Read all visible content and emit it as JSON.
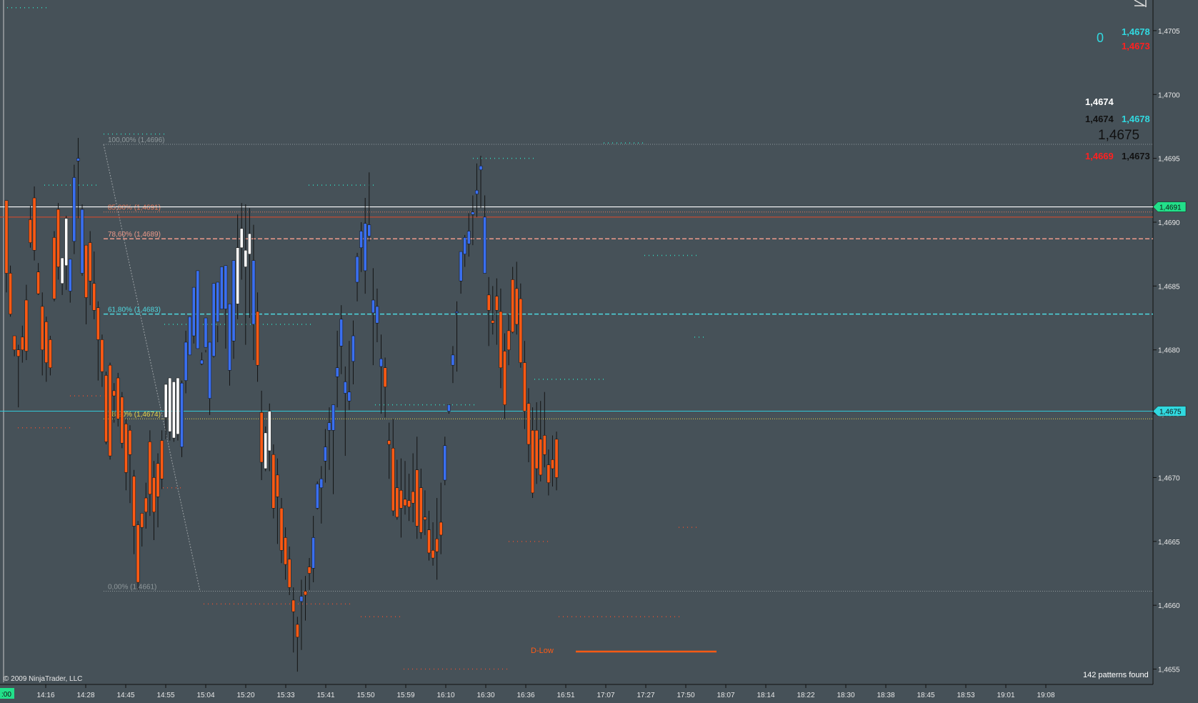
{
  "chart_data": {
    "type": "candlestick",
    "ylim": [
      1.46538,
      1.47074
    ],
    "grid": false,
    "y_tick_labels": [
      "1,4705",
      "1,4700",
      "1,4695",
      "1,4690",
      "1,4685",
      "1,4680",
      "1,4675",
      "1,4670",
      "1,4665",
      "1,4660",
      "1,4655"
    ],
    "y_tick_values": [
      1.4705,
      1.47,
      1.4695,
      1.469,
      1.4685,
      1.468,
      1.4675,
      1.467,
      1.4665,
      1.466,
      1.4655
    ],
    "x_tick_labels": [
      "14:16",
      "14:28",
      "14:45",
      "14:55",
      "15:04",
      "15:20",
      "15:33",
      "15:41",
      "15:50",
      "15:59",
      "16:10",
      "16:30",
      "16:36",
      "16:51",
      "17:07",
      "17:27",
      "17:50",
      "18:07",
      "18:14",
      "18:22",
      "18:30",
      "18:38",
      "18:45",
      "18:53",
      "19:01",
      "19:08"
    ],
    "first_axis_label": ":00",
    "price_tags": [
      {
        "label": "1,4691",
        "value": 1.46912
      },
      {
        "label": "1,4675",
        "value": 1.46752
      }
    ],
    "fib_levels": [
      {
        "label": "100,00% (1,4696)",
        "value": 1.46961,
        "color": "#8f989b"
      },
      {
        "label": "85,00% (1,4691)",
        "value": 1.46908,
        "color": "#e87a5a"
      },
      {
        "label": "78,60% (1,4689)",
        "value": 1.46887,
        "color": "#ee9a8a"
      },
      {
        "label": "61,80% (1,4683)",
        "value": 1.46828,
        "color": "#4fd8e0"
      },
      {
        "label": "38,20% (1,4674)",
        "value": 1.46746,
        "color": "#e8d44a"
      },
      {
        "label": "0,00% (1,4661)",
        "value": 1.46611,
        "color": "#8f989b"
      }
    ],
    "dlow_label": "D-Low",
    "watermark": "© 2009 NinjaTrader, LLC",
    "patterns_text": "142 patterns found",
    "candles": [
      [
        1.46917,
        1.46917,
        1.46845,
        1.4686,
        "o"
      ],
      [
        1.4686,
        1.46866,
        1.46826,
        1.46828,
        "o"
      ],
      [
        1.46811,
        1.46811,
        1.46795,
        1.468,
        "o"
      ],
      [
        1.468,
        1.46804,
        1.46755,
        1.46795,
        "o"
      ],
      [
        1.468,
        1.46819,
        1.4679,
        1.4681,
        "o"
      ],
      [
        1.46839,
        1.46851,
        1.46792,
        1.46799,
        "o"
      ],
      [
        1.46902,
        1.46913,
        1.4688,
        1.46884,
        "o"
      ],
      [
        1.46919,
        1.46928,
        1.4687,
        1.46878,
        "o"
      ],
      [
        1.46861,
        1.46868,
        1.46843,
        1.46844,
        "o"
      ],
      [
        1.46834,
        1.46845,
        1.4678,
        1.468,
        "o"
      ],
      [
        1.46822,
        1.46826,
        1.46775,
        1.4679,
        "o"
      ],
      [
        1.46808,
        1.46811,
        1.4678,
        1.46786,
        "o"
      ],
      [
        1.46888,
        1.46893,
        1.46838,
        1.4684,
        "o"
      ],
      [
        1.4691,
        1.46915,
        1.46855,
        1.46865,
        "o"
      ],
      [
        1.46852,
        1.46871,
        1.46843,
        1.46872,
        "w"
      ],
      [
        1.46866,
        1.46905,
        1.46847,
        1.46903,
        "w"
      ],
      [
        1.46846,
        1.4687,
        1.46837,
        1.46871,
        "b"
      ],
      [
        1.46885,
        1.46945,
        1.46875,
        1.46935,
        "b"
      ],
      [
        1.46948,
        1.46966,
        1.46903,
        1.4695,
        "b"
      ],
      [
        1.4691,
        1.46914,
        1.46858,
        1.4686,
        "b"
      ],
      [
        1.46841,
        1.46875,
        1.4682,
        1.46882,
        "o"
      ],
      [
        1.46884,
        1.46893,
        1.46835,
        1.46854,
        "o"
      ],
      [
        1.46852,
        1.46877,
        1.46824,
        1.46831,
        "o"
      ],
      [
        1.46833,
        1.46838,
        1.46776,
        1.46808,
        "o"
      ],
      [
        1.46808,
        1.46812,
        1.46771,
        1.46783,
        "o"
      ],
      [
        1.4678,
        1.46783,
        1.46726,
        1.46728,
        "o"
      ],
      [
        1.46788,
        1.4679,
        1.46714,
        1.46717,
        "o"
      ],
      [
        1.46768,
        1.46774,
        1.46743,
        1.46764,
        "o"
      ],
      [
        1.46778,
        1.46782,
        1.4674,
        1.46746,
        "o"
      ],
      [
        1.46763,
        1.46767,
        1.46723,
        1.46727,
        "o"
      ],
      [
        1.46742,
        1.46746,
        1.4669,
        1.46704,
        "o"
      ],
      [
        1.46737,
        1.46741,
        1.4668,
        1.46718,
        "o"
      ],
      [
        1.46701,
        1.46706,
        1.4664,
        1.46662,
        "o"
      ],
      [
        1.46663,
        1.46666,
        1.46612,
        1.46618,
        "o"
      ],
      [
        1.46661,
        1.46672,
        1.46646,
        1.46672,
        "o"
      ],
      [
        1.46684,
        1.46696,
        1.4666,
        1.46673,
        "o"
      ],
      [
        1.46728,
        1.46737,
        1.4667,
        1.46687,
        "o"
      ],
      [
        1.467,
        1.46713,
        1.46651,
        1.46673,
        "o"
      ],
      [
        1.46711,
        1.46719,
        1.46661,
        1.46685,
        "o"
      ],
      [
        1.46729,
        1.46737,
        1.46691,
        1.46699,
        "o"
      ],
      [
        1.46747,
        1.46767,
        1.4673,
        1.46773,
        "w"
      ],
      [
        1.46736,
        1.46776,
        1.46729,
        1.46778,
        "w"
      ],
      [
        1.46731,
        1.46769,
        1.46728,
        1.46775,
        "w"
      ],
      [
        1.46734,
        1.46768,
        1.46729,
        1.46778,
        "w"
      ],
      [
        1.46724,
        1.46776,
        1.46716,
        1.46774,
        "b"
      ],
      [
        1.46776,
        1.46815,
        1.46766,
        1.46806,
        "b"
      ],
      [
        1.46796,
        1.46824,
        1.46796,
        1.46826,
        "b"
      ],
      [
        1.46811,
        1.46831,
        1.46805,
        1.46849,
        "b"
      ],
      [
        1.46801,
        1.46812,
        1.46801,
        1.46862,
        "b"
      ],
      [
        1.46789,
        1.46798,
        1.46788,
        1.46792,
        "b"
      ],
      [
        1.46802,
        1.468,
        1.46798,
        1.46825,
        "b"
      ],
      [
        1.46762,
        1.46778,
        1.46749,
        1.46806,
        "b"
      ],
      [
        1.46795,
        1.46803,
        1.46794,
        1.46852,
        "b"
      ],
      [
        1.46822,
        1.46819,
        1.46806,
        1.46853,
        "b"
      ],
      [
        1.46832,
        1.46841,
        1.46836,
        1.46865,
        "b"
      ],
      [
        1.46832,
        1.46864,
        1.46801,
        1.46866,
        "b"
      ],
      [
        1.46784,
        1.46833,
        1.46772,
        1.46836,
        "b"
      ],
      [
        1.46807,
        1.46868,
        1.46793,
        1.4687,
        "b"
      ],
      [
        1.46836,
        1.46906,
        1.46824,
        1.4688,
        "w"
      ],
      [
        1.4688,
        1.46915,
        1.46855,
        1.46895,
        "w"
      ],
      [
        1.46865,
        1.46914,
        1.46804,
        1.46878,
        "w"
      ],
      [
        1.46875,
        1.46911,
        1.46825,
        1.46891,
        "w"
      ],
      [
        1.4682,
        1.46898,
        1.46792,
        1.4687,
        "b"
      ],
      [
        1.4683,
        1.46845,
        1.46775,
        1.46788,
        "o"
      ],
      [
        1.46751,
        1.46768,
        1.46698,
        1.46712,
        "o"
      ],
      [
        1.46735,
        1.4674,
        1.46705,
        1.46707,
        "w"
      ],
      [
        1.46721,
        1.46758,
        1.46705,
        1.46752,
        "w"
      ],
      [
        1.46718,
        1.46726,
        1.46668,
        1.46676,
        "o"
      ],
      [
        1.46702,
        1.46715,
        1.46648,
        1.46685,
        "o"
      ],
      [
        1.46676,
        1.46684,
        1.46633,
        1.46643,
        "o"
      ],
      [
        1.46653,
        1.46661,
        1.4662,
        1.46632,
        "o"
      ],
      [
        1.46636,
        1.46646,
        1.46608,
        1.46614,
        "o"
      ],
      [
        1.46604,
        1.46614,
        1.46563,
        1.46595,
        "o"
      ],
      [
        1.46575,
        1.46591,
        1.46548,
        1.46585,
        "o"
      ],
      [
        1.46607,
        1.4662,
        1.46565,
        1.46603,
        "b"
      ],
      [
        1.46608,
        1.46623,
        1.46588,
        1.46611,
        "o"
      ],
      [
        1.4663,
        1.46637,
        1.46612,
        1.46625,
        "o"
      ],
      [
        1.46653,
        1.4667,
        1.46618,
        1.46629,
        "b"
      ],
      [
        1.46676,
        1.46697,
        1.46675,
        1.46695,
        "b"
      ],
      [
        1.46692,
        1.46709,
        1.46664,
        1.46699,
        "b"
      ],
      [
        1.46713,
        1.46738,
        1.46696,
        1.46724,
        "b"
      ],
      [
        1.46737,
        1.46755,
        1.46706,
        1.46743,
        "b"
      ],
      [
        1.46737,
        1.46755,
        1.46687,
        1.46757,
        "b"
      ],
      [
        1.46786,
        1.46815,
        1.46755,
        1.46779,
        "b"
      ],
      [
        1.46824,
        1.46835,
        1.46781,
        1.46803,
        "b"
      ],
      [
        1.46775,
        1.46787,
        1.46717,
        1.46766,
        "b"
      ],
      [
        1.46767,
        1.46807,
        1.46753,
        1.4676,
        "b"
      ],
      [
        1.46791,
        1.46823,
        1.46773,
        1.46811,
        "b"
      ],
      [
        1.46853,
        1.46876,
        1.46838,
        1.46873,
        "b"
      ],
      [
        1.4688,
        1.469,
        1.46861,
        1.46893,
        "b"
      ],
      [
        1.46862,
        1.46919,
        1.46844,
        1.46899,
        "b"
      ],
      [
        1.46889,
        1.46939,
        1.46885,
        1.46898,
        "b"
      ],
      [
        1.46839,
        1.46864,
        1.46788,
        1.46829,
        "b"
      ],
      [
        1.46834,
        1.46848,
        1.46806,
        1.46821,
        "b"
      ],
      [
        1.46793,
        1.46812,
        1.4675,
        1.46787,
        "b"
      ],
      [
        1.46771,
        1.46794,
        1.46747,
        1.46786,
        "o"
      ],
      [
        1.46729,
        1.46743,
        1.46699,
        1.46726,
        "o"
      ],
      [
        1.46723,
        1.46746,
        1.4667,
        1.46674,
        "o"
      ],
      [
        1.46692,
        1.46714,
        1.46667,
        1.46669,
        "o"
      ],
      [
        1.4669,
        1.46715,
        1.46653,
        1.46676,
        "o"
      ],
      [
        1.46683,
        1.46713,
        1.46671,
        1.46678,
        "o"
      ],
      [
        1.46682,
        1.46703,
        1.46666,
        1.46677,
        "o"
      ],
      [
        1.46689,
        1.46719,
        1.46665,
        1.4668,
        "o"
      ],
      [
        1.46706,
        1.46732,
        1.46652,
        1.46662,
        "o"
      ],
      [
        1.46692,
        1.46707,
        1.46652,
        1.46657,
        "o"
      ],
      [
        1.46669,
        1.4669,
        1.46655,
        1.46667,
        "o"
      ],
      [
        1.46659,
        1.46674,
        1.46635,
        1.46641,
        "o"
      ],
      [
        1.46643,
        1.46665,
        1.46631,
        1.46637,
        "o"
      ],
      [
        1.46652,
        1.46684,
        1.4662,
        1.46642,
        "o"
      ],
      [
        1.46665,
        1.46696,
        1.4664,
        1.46655,
        "o"
      ],
      [
        1.46698,
        1.46732,
        1.46694,
        1.46725,
        "b"
      ],
      [
        1.46752,
        1.46757,
        1.4675,
        1.46757,
        "b"
      ],
      [
        1.46788,
        1.46803,
        1.46774,
        1.46796,
        "b"
      ],
      [
        1.4683,
        1.46838,
        1.46783,
        1.46829,
        "b"
      ],
      [
        1.46854,
        1.46877,
        1.46844,
        1.46877,
        "b"
      ],
      [
        1.46875,
        1.4689,
        1.46865,
        1.46888,
        "b"
      ],
      [
        1.46883,
        1.46907,
        1.46873,
        1.46893,
        "b"
      ],
      [
        1.46906,
        1.46921,
        1.46882,
        1.46908,
        "b"
      ],
      [
        1.46925,
        1.46946,
        1.46904,
        1.46922,
        "b"
      ],
      [
        1.46944,
        1.46952,
        1.46911,
        1.46941,
        "b"
      ],
      [
        1.46904,
        1.46921,
        1.46862,
        1.4686,
        "b"
      ],
      [
        1.46843,
        1.46857,
        1.46803,
        1.46831,
        "o"
      ],
      [
        1.46823,
        1.4685,
        1.46812,
        1.46821,
        "o"
      ],
      [
        1.46842,
        1.46856,
        1.46804,
        1.46831,
        "o"
      ],
      [
        1.4683,
        1.46848,
        1.4677,
        1.46786,
        "o"
      ],
      [
        1.46799,
        1.46813,
        1.46746,
        1.46757,
        "o"
      ],
      [
        1.46815,
        1.46828,
        1.46788,
        1.468,
        "o"
      ],
      [
        1.46855,
        1.46865,
        1.46813,
        1.46814,
        "o"
      ],
      [
        1.46848,
        1.46869,
        1.46812,
        1.4682,
        "o"
      ],
      [
        1.4684,
        1.46852,
        1.46786,
        1.4679,
        "o"
      ],
      [
        1.4679,
        1.46807,
        1.46738,
        1.46752,
        "o"
      ],
      [
        1.46758,
        1.4677,
        1.46712,
        1.46726,
        "o"
      ],
      [
        1.46737,
        1.46755,
        1.46684,
        1.46688,
        "o"
      ],
      [
        1.46737,
        1.46759,
        1.46695,
        1.46707,
        "o"
      ],
      [
        1.4673,
        1.4676,
        1.46697,
        1.46702,
        "o"
      ],
      [
        1.46733,
        1.46767,
        1.46708,
        1.46718,
        "o"
      ],
      [
        1.4671,
        1.46722,
        1.46686,
        1.46696,
        "o"
      ],
      [
        1.46714,
        1.46733,
        1.46693,
        1.46707,
        "o"
      ],
      [
        1.4673,
        1.46736,
        1.4669,
        1.467,
        "o"
      ]
    ]
  },
  "top_right": {
    "zero_value": "0",
    "val_cyan_top": "1,4678",
    "val_red_top": "1,4673",
    "val_white_1": "1,4674",
    "val_black_1": "1,4674",
    "val_cyan_2": "1,4678",
    "val_center": "1,4675",
    "val_red_3": "1,4669",
    "val_black_3": "1,4673"
  },
  "colors": {
    "background": "#465158",
    "up": "#3a6ff0",
    "down": "#ff5a14",
    "neutral": "#ffffff",
    "axis_text": "#e8e8e8",
    "tag_green": "#22e08a",
    "tag_cyan": "#31d9e0"
  },
  "icons": [
    "triangle-play-icon"
  ]
}
